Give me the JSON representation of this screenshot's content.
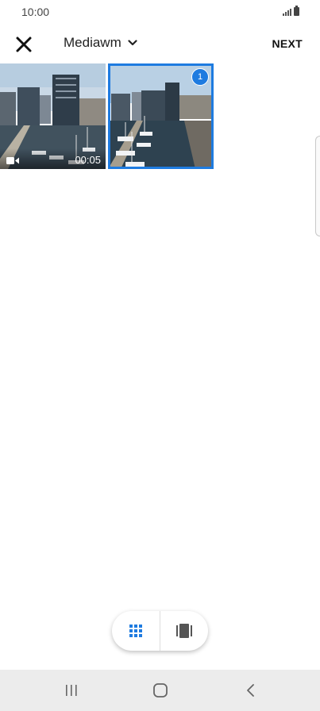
{
  "status_bar": {
    "time": "10:00",
    "icons": [
      "signal-icon",
      "battery-icon"
    ]
  },
  "header": {
    "close_icon": "close-icon",
    "album_name": "Mediawm",
    "album_chevron_icon": "chevron-down-icon",
    "next_label": "NEXT"
  },
  "media_grid": {
    "items": [
      {
        "type": "video",
        "duration": "00:05",
        "selected": false
      },
      {
        "type": "photo",
        "selected": true,
        "selection_index": "1"
      }
    ]
  },
  "view_toggle": {
    "options": [
      "grid-view-icon",
      "single-view-icon"
    ],
    "active": "grid-view-icon"
  },
  "navigation_bar": {
    "buttons": [
      "recent-apps-icon",
      "home-icon",
      "back-icon"
    ]
  },
  "colors": {
    "accent": "#1e7be0",
    "nav_background": "#ececec"
  }
}
